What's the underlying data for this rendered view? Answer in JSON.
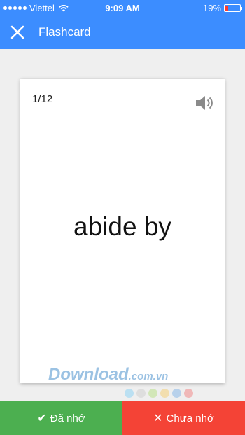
{
  "status_bar": {
    "carrier": "Viettel",
    "time": "9:09 AM",
    "battery_percent": "19%",
    "battery_level": 0.19
  },
  "header": {
    "title": "Flashcard",
    "close_icon": "close-icon"
  },
  "card": {
    "counter": "1/12",
    "word": "abide by",
    "speaker_icon": "speaker-icon"
  },
  "watermark": {
    "main": "Download",
    "domain": ".com.vn"
  },
  "dot_colors": [
    "#8fd3f4",
    "#cfcfcf",
    "#b9e08a",
    "#f4d07a",
    "#8ab8e8",
    "#f08a8a"
  ],
  "actions": {
    "remembered": "Đã nhớ",
    "not_remembered": "Chưa nhớ"
  },
  "colors": {
    "primary": "#3c8dff",
    "green": "#4caf50",
    "red": "#f44336"
  }
}
